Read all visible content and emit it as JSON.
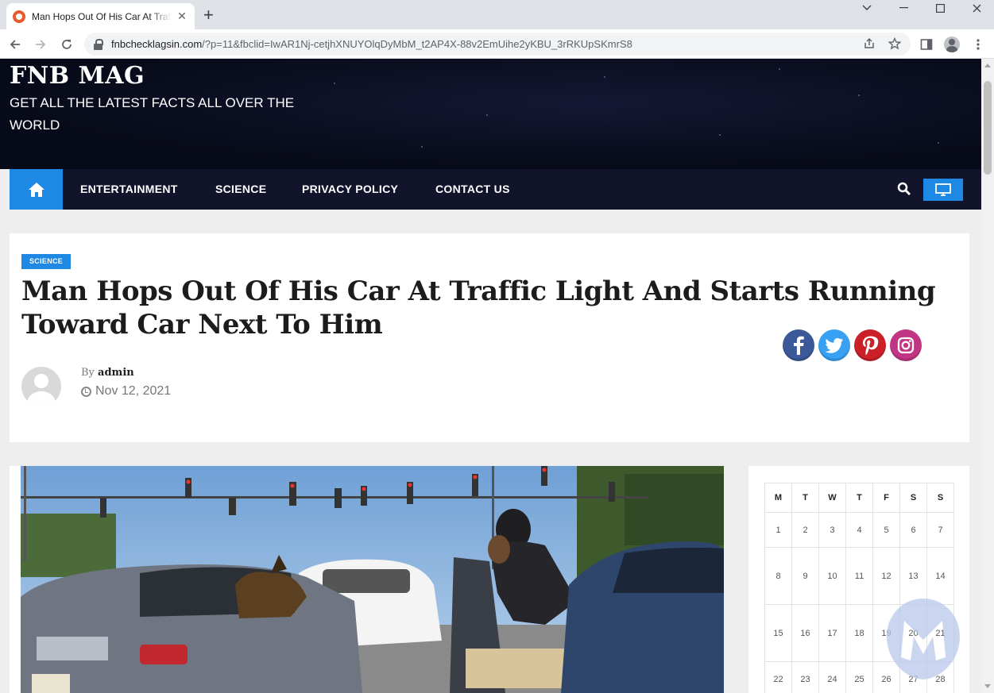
{
  "browser": {
    "tab_title": "Man Hops Out Of His Car At Traffic Light And Starts Running Toward Car Next To Him",
    "new_tab_icon": "plus-icon",
    "window_controls": [
      "chevron-down-icon",
      "minimize-icon",
      "maximize-icon",
      "close-icon"
    ],
    "url_host": "fnbchecklagsin.com",
    "url_path": "/?p=11&fbclid=IwAR1Nj-cetjhXNUYOlqDyMbM_t2AP4X-88v2EmUihe2yKBU_3rRKUpSKmrS8"
  },
  "site": {
    "title": "FNB MAG",
    "tagline": "GET ALL THE LATEST FACTS ALL OVER THE WORLD"
  },
  "nav": {
    "items": [
      "ENTERTAINMENT",
      "SCIENCE",
      "PRIVACY POLICY",
      "CONTACT US"
    ],
    "accent": "#1e88e5",
    "bar_color": "#12142c"
  },
  "article": {
    "category": "SCIENCE",
    "title": "Man Hops Out Of His Car At Traffic Light And Starts Running Toward Car Next To Him",
    "by_prefix": "By",
    "author": "admin",
    "date": "Nov 12, 2021",
    "share": [
      {
        "name": "facebook",
        "color": "#3b5998"
      },
      {
        "name": "twitter",
        "color": "#38a1f3"
      },
      {
        "name": "pinterest",
        "color": "#cb2027"
      },
      {
        "name": "instagram",
        "color": "#c13584"
      }
    ]
  },
  "calendar": {
    "headers": [
      "M",
      "T",
      "W",
      "T",
      "F",
      "S",
      "S"
    ],
    "rows": [
      [
        "1",
        "2",
        "3",
        "4",
        "5",
        "6",
        "7"
      ],
      [
        "8",
        "9",
        "10",
        "11",
        "12",
        "13",
        "14"
      ],
      [
        "15",
        "16",
        "17",
        "18",
        "19",
        "20",
        "21"
      ],
      [
        "22",
        "23",
        "24",
        "25",
        "26",
        "27",
        "28"
      ]
    ]
  }
}
